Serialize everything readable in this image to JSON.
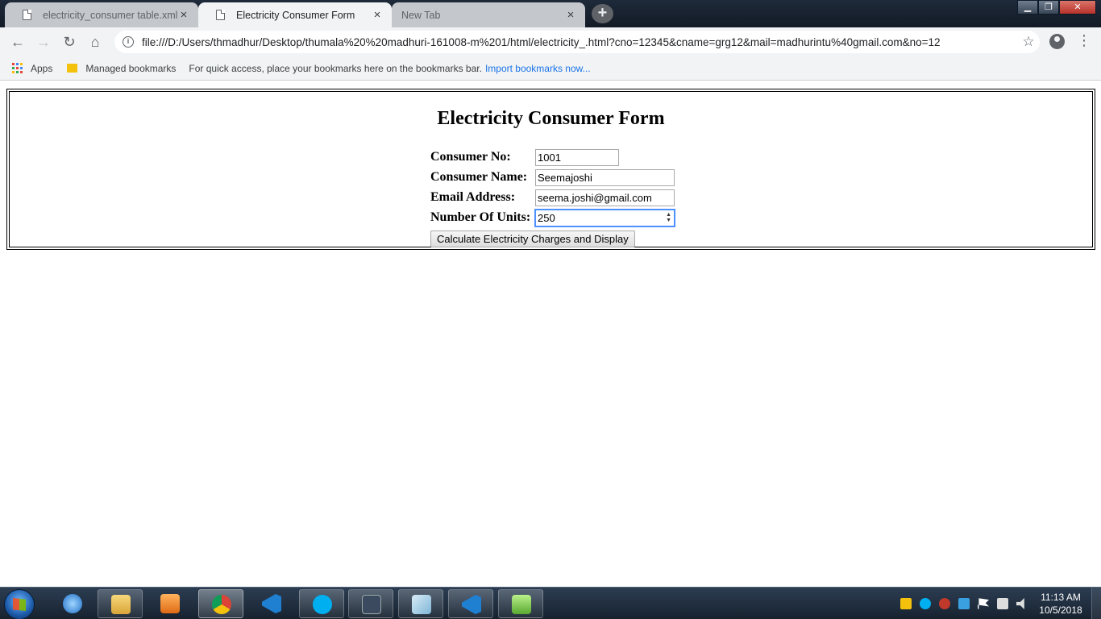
{
  "browser": {
    "tabs": [
      {
        "title": "electricity_consumer table.xml",
        "close": "×"
      },
      {
        "title": "Electricity Consumer Form",
        "close": "×"
      },
      {
        "title": "New Tab",
        "close": "×"
      }
    ],
    "new_tab": "+",
    "window_controls": {
      "minimize": "▁",
      "restore": "❐",
      "close": "✕"
    },
    "nav": {
      "back": "←",
      "forward": "→",
      "reload": "↻",
      "home": "⌂"
    },
    "info_icon": "i",
    "url": "file:///D:/Users/thmadhur/Desktop/thumala%20%20madhuri-161008-m%201/html/electricity_.html?cno=12345&cname=grg12&mail=madhurintu%40gmail.com&no=12",
    "star": "☆",
    "menu": "⋮"
  },
  "bookmarks": {
    "apps": "Apps",
    "managed": "Managed bookmarks",
    "hint": "For quick access, place your bookmarks here on the bookmarks bar.",
    "import_link": "Import bookmarks now..."
  },
  "form": {
    "title": "Electricity Consumer Form",
    "fields": [
      {
        "label": "Consumer No:",
        "value": "1001"
      },
      {
        "label": "Consumer Name:",
        "value": "Seemajoshi"
      },
      {
        "label": "Email Address:",
        "value": "seema.joshi@gmail.com"
      },
      {
        "label": "Number Of Units:",
        "value": "250"
      }
    ],
    "spinner": "▲▼",
    "submit_label": "Calculate Electricity Charges and Display"
  },
  "taskbar": {
    "clock_time": "11:13 AM",
    "clock_date": "10/5/2018"
  },
  "colors": {
    "accent": "#1a73e8",
    "focus": "#4d90fe",
    "taskbar": "#17222f"
  }
}
